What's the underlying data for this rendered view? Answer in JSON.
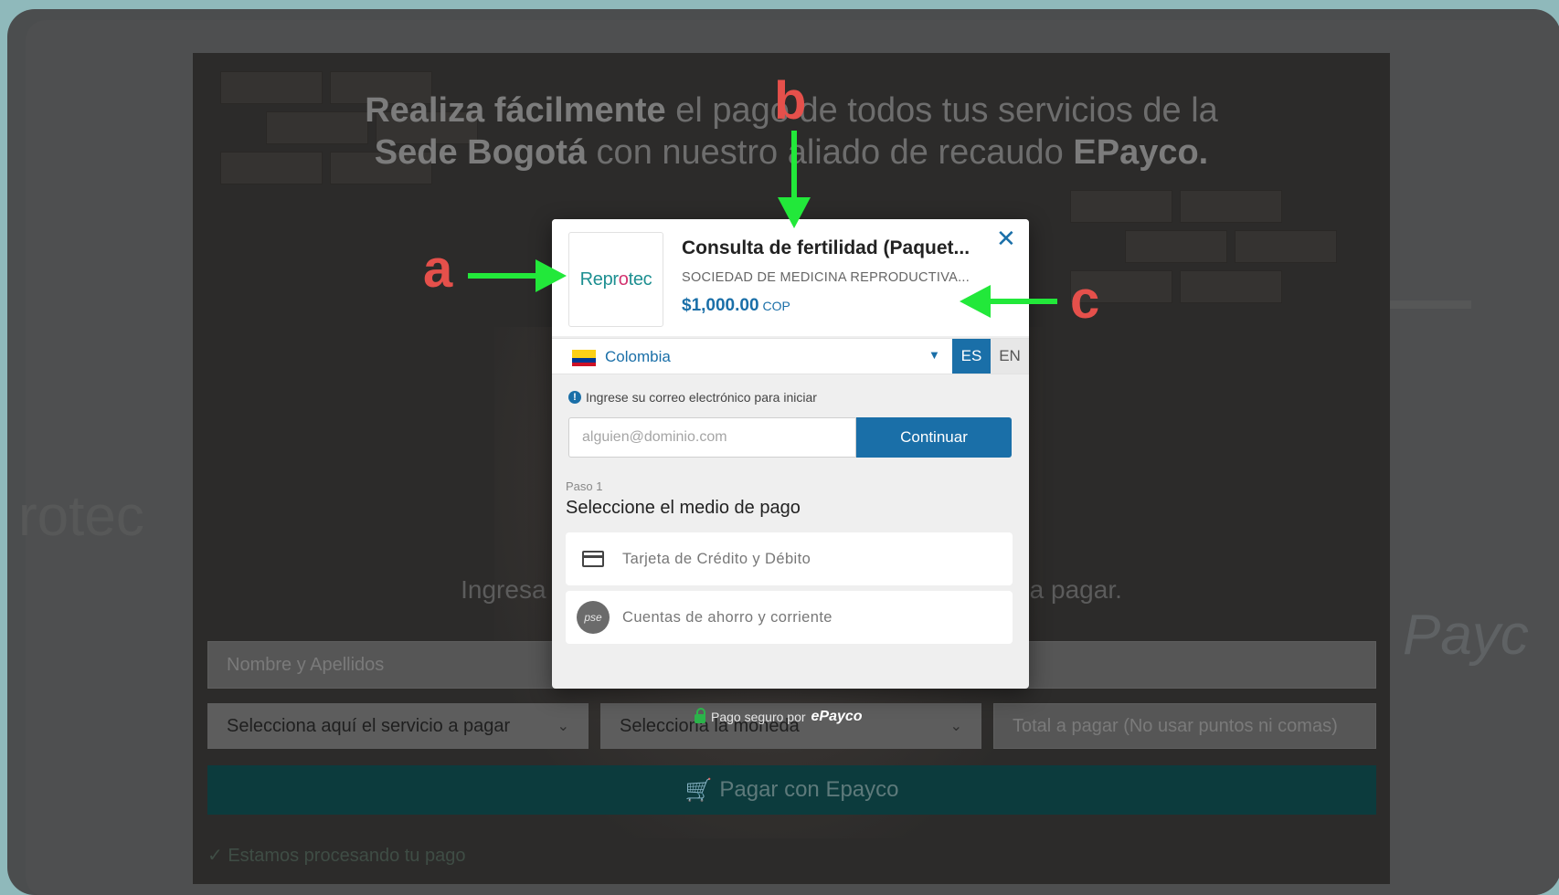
{
  "background_page": {
    "headline_bold_1": "Realiza fácilmente",
    "headline_normal_1": " el pago de todos tus servicios de la",
    "headline_bold_2": "Sede Bogotá",
    "headline_normal_2": " con nuestro aliado de recaudo ",
    "headline_bold_3": "EPayco.",
    "subhead": "Ingresa tus datos y selecciona el servicio que vas a pagar.",
    "name_placeholder": "Nombre y Apellidos",
    "service_select": "Selecciona aquí el servicio a pagar",
    "currency_select": "Selecciona la moneda",
    "total_placeholder": "Total a pagar (No usar puntos ni comas)",
    "pay_button": "Pagar con Epayco",
    "processing_text": "✓ Estamos procesando tu pago",
    "close_glyph": "×",
    "side_text_left": "rotec",
    "side_text_right": "Payc"
  },
  "modal": {
    "logo_text_1": "Repr",
    "logo_text_2": "o",
    "logo_text_3": "tec",
    "title": "Consulta de fertilidad (Paquet...",
    "merchant": "SOCIEDAD DE MEDICINA REPRODUCTIVA...",
    "price": "$1,000.00",
    "currency": "COP",
    "close_glyph": "✕",
    "country": "Colombia",
    "lang_es": "ES",
    "lang_en": "EN",
    "info_text": "Ingrese su correo electrónico para iniciar",
    "email_placeholder": "alguien@dominio.com",
    "continue_button": "Continuar",
    "step_label": "Paso 1",
    "step_title": "Seleccione el medio de pago",
    "payment_options": [
      {
        "label": "Tarjeta de Crédito y Débito",
        "icon": "credit-card-icon"
      },
      {
        "label": "Cuentas de ahorro y corriente",
        "icon": "pse-icon"
      }
    ],
    "pse_text": "pse",
    "secure_text": "Pago seguro por",
    "secure_brand": "ePayco"
  },
  "annotations": {
    "a": "a",
    "b": "b",
    "c": "c",
    "letter_color": "#e5504b",
    "arrow_color": "#22e83a"
  }
}
